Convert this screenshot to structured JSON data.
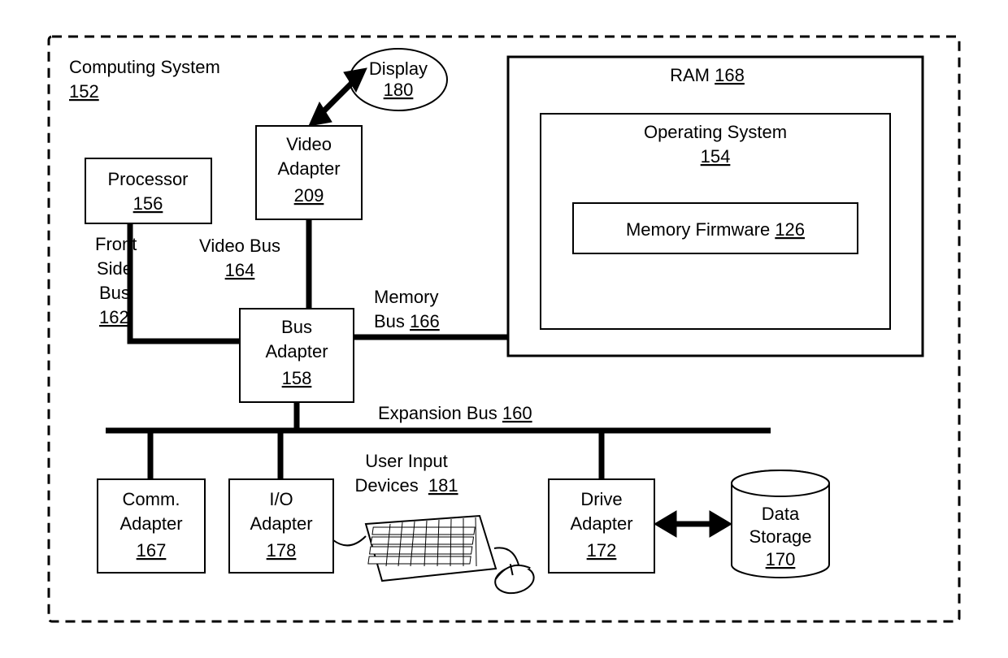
{
  "diagram": {
    "system": {
      "title": "Computing System",
      "ref": "152"
    },
    "processor": {
      "title": "Processor",
      "ref": "156"
    },
    "videoAdapter": {
      "title1": "Video",
      "title2": "Adapter",
      "ref": "209"
    },
    "display": {
      "title": "Display",
      "ref": "180"
    },
    "busAdapter": {
      "title1": "Bus",
      "title2": "Adapter",
      "ref": "158"
    },
    "fsb": {
      "l1": "Front",
      "l2": "Side",
      "l3": "Bus",
      "ref": "162"
    },
    "videoBus": {
      "title": "Video Bus",
      "ref": "164"
    },
    "memoryBus": {
      "l1": "Memory",
      "l2": "Bus",
      "ref": "166"
    },
    "expansionBus": {
      "title": "Expansion Bus",
      "ref": "160"
    },
    "ram": {
      "title": "RAM",
      "ref": "168"
    },
    "os": {
      "title": "Operating System",
      "ref": "154"
    },
    "memFirmware": {
      "title": "Memory Firmware",
      "ref": "126"
    },
    "commAdapter": {
      "title1": "Comm.",
      "title2": "Adapter",
      "ref": "167"
    },
    "ioAdapter": {
      "title1": "I/O",
      "title2": "Adapter",
      "ref": "178"
    },
    "driveAdapter": {
      "title1": "Drive",
      "title2": "Adapter",
      "ref": "172"
    },
    "dataStorage": {
      "title1": "Data",
      "title2": "Storage",
      "ref": "170"
    },
    "inputDevices": {
      "l1": "User Input",
      "l2": "Devices",
      "ref": "181"
    }
  }
}
